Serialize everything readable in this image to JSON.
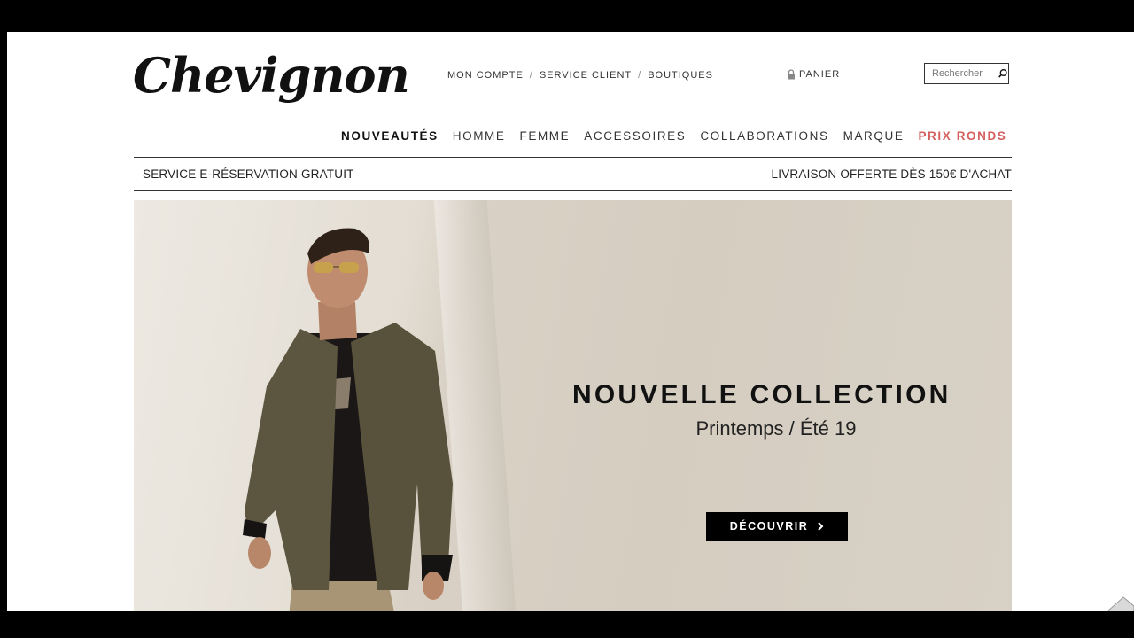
{
  "brand": {
    "logo": "Chevignon"
  },
  "top_links": [
    "MON COMPTE",
    "SERVICE CLIENT",
    "BOUTIQUES"
  ],
  "separator": "/",
  "cart": {
    "label": "PANIER",
    "icon": "lock-icon"
  },
  "search": {
    "placeholder": "Rechercher",
    "icon": "search-icon"
  },
  "nav": {
    "items": [
      "NOUVEAUTÉS",
      "HOMME",
      "FEMME",
      "ACCESSOIRES",
      "COLLABORATIONS",
      "MARQUE",
      "PRIX RONDS"
    ],
    "active": "NOUVEAUTÉS",
    "promo_color": "#d45f5f"
  },
  "info_bar": {
    "left": "SERVICE E-RÉSERVATION GRATUIT",
    "right": "LIVRAISON OFFERTE DÈS 150€ D'ACHAT"
  },
  "hero": {
    "title": "NOUVELLE COLLECTION",
    "subtitle": "Printemps / Été 19",
    "cta_label": "DÉCOUVRIR",
    "cta_icon": "chevron-right-icon"
  }
}
